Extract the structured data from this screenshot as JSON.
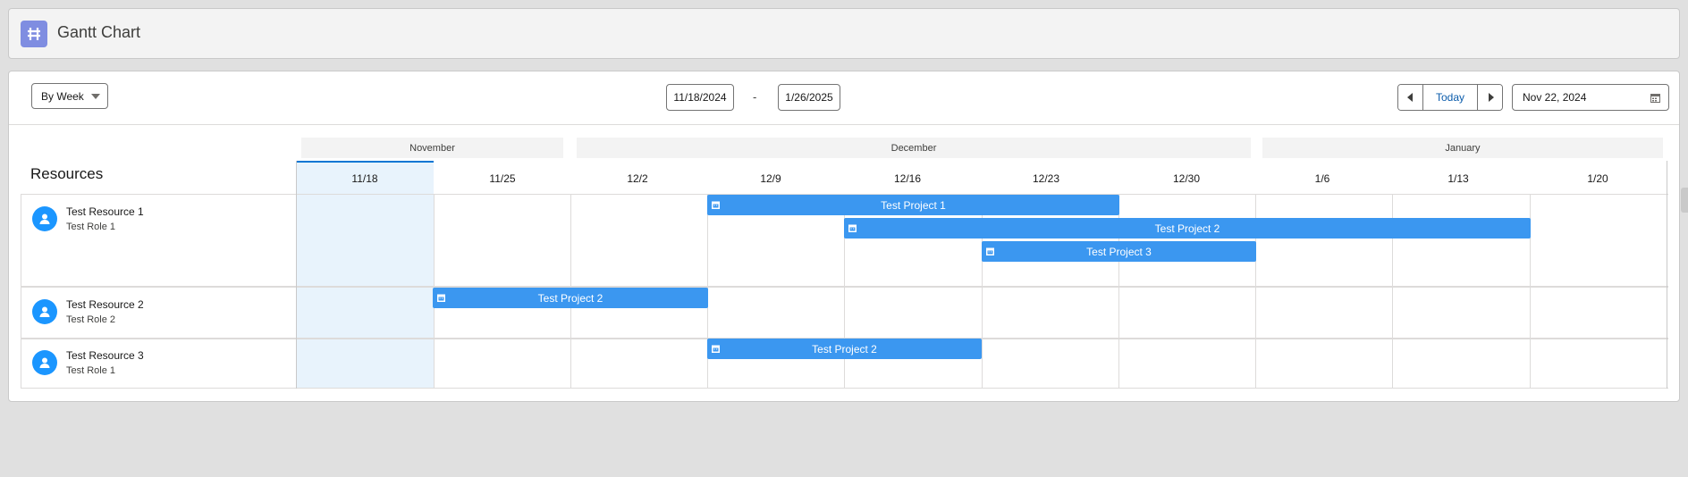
{
  "app": {
    "title": "Gantt Chart"
  },
  "toolbar": {
    "view_label": "By Week",
    "start_date": "11/18/2024",
    "range_separator": "-",
    "end_date": "1/26/2025",
    "today_label": "Today",
    "current_date": "Nov 22, 2024"
  },
  "months": [
    "November",
    "December",
    "January"
  ],
  "weeks": [
    "11/18",
    "11/25",
    "12/2",
    "12/9",
    "12/16",
    "12/23",
    "12/30",
    "1/6",
    "1/13",
    "1/20"
  ],
  "resources_title": "Resources",
  "resources": [
    {
      "name": "Test Resource 1",
      "role": "Test Role 1"
    },
    {
      "name": "Test Resource 2",
      "role": "Test Role 2"
    },
    {
      "name": "Test Resource 3",
      "role": "Test Role 1"
    }
  ],
  "bars": [
    {
      "label": "Test Project 1",
      "resource": 0
    },
    {
      "label": "Test Project 2",
      "resource": 0
    },
    {
      "label": "Test Project 3",
      "resource": 0
    },
    {
      "label": "Test Project 2",
      "resource": 1
    },
    {
      "label": "Test Project 2",
      "resource": 2
    }
  ],
  "colors": {
    "bar": "#3b97f0",
    "accent": "#0176d3",
    "avatar": "#1b96ff",
    "app_icon": "#7f8de1"
  }
}
